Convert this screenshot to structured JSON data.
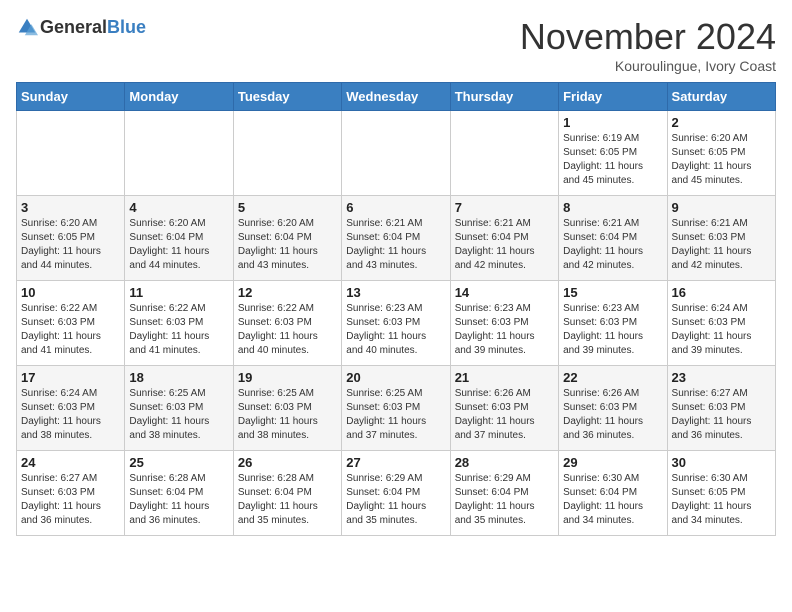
{
  "header": {
    "logo_general": "General",
    "logo_blue": "Blue",
    "month_title": "November 2024",
    "location": "Kouroulingue, Ivory Coast"
  },
  "days_of_week": [
    "Sunday",
    "Monday",
    "Tuesday",
    "Wednesday",
    "Thursday",
    "Friday",
    "Saturday"
  ],
  "weeks": [
    [
      {
        "day": "",
        "info": ""
      },
      {
        "day": "",
        "info": ""
      },
      {
        "day": "",
        "info": ""
      },
      {
        "day": "",
        "info": ""
      },
      {
        "day": "",
        "info": ""
      },
      {
        "day": "1",
        "info": "Sunrise: 6:19 AM\nSunset: 6:05 PM\nDaylight: 11 hours\nand 45 minutes."
      },
      {
        "day": "2",
        "info": "Sunrise: 6:20 AM\nSunset: 6:05 PM\nDaylight: 11 hours\nand 45 minutes."
      }
    ],
    [
      {
        "day": "3",
        "info": "Sunrise: 6:20 AM\nSunset: 6:05 PM\nDaylight: 11 hours\nand 44 minutes."
      },
      {
        "day": "4",
        "info": "Sunrise: 6:20 AM\nSunset: 6:04 PM\nDaylight: 11 hours\nand 44 minutes."
      },
      {
        "day": "5",
        "info": "Sunrise: 6:20 AM\nSunset: 6:04 PM\nDaylight: 11 hours\nand 43 minutes."
      },
      {
        "day": "6",
        "info": "Sunrise: 6:21 AM\nSunset: 6:04 PM\nDaylight: 11 hours\nand 43 minutes."
      },
      {
        "day": "7",
        "info": "Sunrise: 6:21 AM\nSunset: 6:04 PM\nDaylight: 11 hours\nand 42 minutes."
      },
      {
        "day": "8",
        "info": "Sunrise: 6:21 AM\nSunset: 6:04 PM\nDaylight: 11 hours\nand 42 minutes."
      },
      {
        "day": "9",
        "info": "Sunrise: 6:21 AM\nSunset: 6:03 PM\nDaylight: 11 hours\nand 42 minutes."
      }
    ],
    [
      {
        "day": "10",
        "info": "Sunrise: 6:22 AM\nSunset: 6:03 PM\nDaylight: 11 hours\nand 41 minutes."
      },
      {
        "day": "11",
        "info": "Sunrise: 6:22 AM\nSunset: 6:03 PM\nDaylight: 11 hours\nand 41 minutes."
      },
      {
        "day": "12",
        "info": "Sunrise: 6:22 AM\nSunset: 6:03 PM\nDaylight: 11 hours\nand 40 minutes."
      },
      {
        "day": "13",
        "info": "Sunrise: 6:23 AM\nSunset: 6:03 PM\nDaylight: 11 hours\nand 40 minutes."
      },
      {
        "day": "14",
        "info": "Sunrise: 6:23 AM\nSunset: 6:03 PM\nDaylight: 11 hours\nand 39 minutes."
      },
      {
        "day": "15",
        "info": "Sunrise: 6:23 AM\nSunset: 6:03 PM\nDaylight: 11 hours\nand 39 minutes."
      },
      {
        "day": "16",
        "info": "Sunrise: 6:24 AM\nSunset: 6:03 PM\nDaylight: 11 hours\nand 39 minutes."
      }
    ],
    [
      {
        "day": "17",
        "info": "Sunrise: 6:24 AM\nSunset: 6:03 PM\nDaylight: 11 hours\nand 38 minutes."
      },
      {
        "day": "18",
        "info": "Sunrise: 6:25 AM\nSunset: 6:03 PM\nDaylight: 11 hours\nand 38 minutes."
      },
      {
        "day": "19",
        "info": "Sunrise: 6:25 AM\nSunset: 6:03 PM\nDaylight: 11 hours\nand 38 minutes."
      },
      {
        "day": "20",
        "info": "Sunrise: 6:25 AM\nSunset: 6:03 PM\nDaylight: 11 hours\nand 37 minutes."
      },
      {
        "day": "21",
        "info": "Sunrise: 6:26 AM\nSunset: 6:03 PM\nDaylight: 11 hours\nand 37 minutes."
      },
      {
        "day": "22",
        "info": "Sunrise: 6:26 AM\nSunset: 6:03 PM\nDaylight: 11 hours\nand 36 minutes."
      },
      {
        "day": "23",
        "info": "Sunrise: 6:27 AM\nSunset: 6:03 PM\nDaylight: 11 hours\nand 36 minutes."
      }
    ],
    [
      {
        "day": "24",
        "info": "Sunrise: 6:27 AM\nSunset: 6:03 PM\nDaylight: 11 hours\nand 36 minutes."
      },
      {
        "day": "25",
        "info": "Sunrise: 6:28 AM\nSunset: 6:04 PM\nDaylight: 11 hours\nand 36 minutes."
      },
      {
        "day": "26",
        "info": "Sunrise: 6:28 AM\nSunset: 6:04 PM\nDaylight: 11 hours\nand 35 minutes."
      },
      {
        "day": "27",
        "info": "Sunrise: 6:29 AM\nSunset: 6:04 PM\nDaylight: 11 hours\nand 35 minutes."
      },
      {
        "day": "28",
        "info": "Sunrise: 6:29 AM\nSunset: 6:04 PM\nDaylight: 11 hours\nand 35 minutes."
      },
      {
        "day": "29",
        "info": "Sunrise: 6:30 AM\nSunset: 6:04 PM\nDaylight: 11 hours\nand 34 minutes."
      },
      {
        "day": "30",
        "info": "Sunrise: 6:30 AM\nSunset: 6:05 PM\nDaylight: 11 hours\nand 34 minutes."
      }
    ]
  ]
}
